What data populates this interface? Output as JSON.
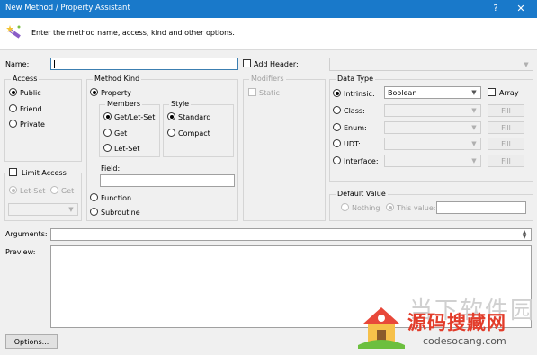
{
  "window": {
    "title": "New Method / Property Assistant",
    "help": "?",
    "close": "✕"
  },
  "header": {
    "message": "Enter the method name, access, kind and other options."
  },
  "name": {
    "label": "Name:",
    "value": ""
  },
  "add_header": {
    "label": "Add Header:",
    "checked": false
  },
  "access": {
    "title": "Access",
    "options": [
      "Public",
      "Friend",
      "Private"
    ],
    "selected": "Public"
  },
  "limit_access": {
    "label": "Limit Access",
    "options": [
      "Let-Set",
      "Get"
    ],
    "selected": "Let-Set"
  },
  "method_kind": {
    "title": "Method Kind",
    "property_label": "Property",
    "members_title": "Members",
    "members": [
      "Get/Let-Set",
      "Get",
      "Let-Set"
    ],
    "members_selected": "Get/Let-Set",
    "style_title": "Style",
    "styles": [
      "Standard",
      "Compact"
    ],
    "style_selected": "Standard",
    "field_label": "Field:",
    "field_value": "",
    "function_label": "Function",
    "subroutine_label": "Subroutine",
    "selected": "Property"
  },
  "modifiers": {
    "title": "Modifiers",
    "static_label": "Static"
  },
  "data_type": {
    "title": "Data Type",
    "intrinsic_label": "Intrinsic:",
    "intrinsic_value": "Boolean",
    "array_label": "Array",
    "class_label": "Class:",
    "enum_label": "Enum:",
    "udt_label": "UDT:",
    "interface_label": "Interface:",
    "fill_label": "Fill",
    "selected": "Intrinsic"
  },
  "default_value": {
    "title": "Default Value",
    "nothing_label": "Nothing",
    "this_value_label": "This value:",
    "selected": "This value"
  },
  "arguments": {
    "label": "Arguments:",
    "value": ""
  },
  "preview": {
    "label": "Preview:",
    "value": ""
  },
  "options_button": {
    "label": "Options..."
  },
  "watermark": {
    "brand": "源码搜藏网",
    "url": "codesocang.com",
    "faded": "当下软件园"
  }
}
